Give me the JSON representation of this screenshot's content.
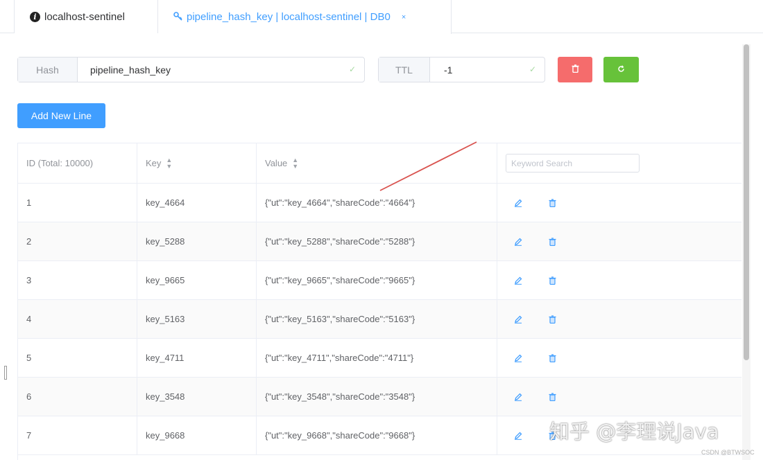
{
  "tabs": [
    {
      "label": "localhost-sentinel",
      "icon": "info-icon",
      "active": false
    },
    {
      "label": "pipeline_hash_key | localhost-sentinel | DB0",
      "icon": "key-icon",
      "active": true,
      "close": "×"
    }
  ],
  "form": {
    "hash_label": "Hash",
    "hash_value": "pipeline_hash_key",
    "ttl_label": "TTL",
    "ttl_value": "-1"
  },
  "buttons": {
    "add_label": "Add New Line"
  },
  "table": {
    "columns": [
      "ID (Total: 10000)",
      "Key",
      "Value"
    ],
    "search_placeholder": "Keyword Search",
    "rows": [
      {
        "id": "1",
        "key": "key_4664",
        "value": "{\"ut\":\"key_4664\",\"shareCode\":\"4664\"}"
      },
      {
        "id": "2",
        "key": "key_5288",
        "value": "{\"ut\":\"key_5288\",\"shareCode\":\"5288\"}"
      },
      {
        "id": "3",
        "key": "key_9665",
        "value": "{\"ut\":\"key_9665\",\"shareCode\":\"9665\"}"
      },
      {
        "id": "4",
        "key": "key_5163",
        "value": "{\"ut\":\"key_5163\",\"shareCode\":\"5163\"}"
      },
      {
        "id": "5",
        "key": "key_4711",
        "value": "{\"ut\":\"key_4711\",\"shareCode\":\"4711\"}"
      },
      {
        "id": "6",
        "key": "key_3548",
        "value": "{\"ut\":\"key_3548\",\"shareCode\":\"3548\"}"
      },
      {
        "id": "7",
        "key": "key_9668",
        "value": "{\"ut\":\"key_9668\",\"shareCode\":\"9668\"}"
      }
    ]
  },
  "watermark": "知乎 @李理说Java",
  "sub_watermark": "CSDN @BTWSOC",
  "colors": {
    "primary": "#409eff",
    "danger": "#f56c6c",
    "success": "#67c23a",
    "annotation": "#d9534f"
  }
}
